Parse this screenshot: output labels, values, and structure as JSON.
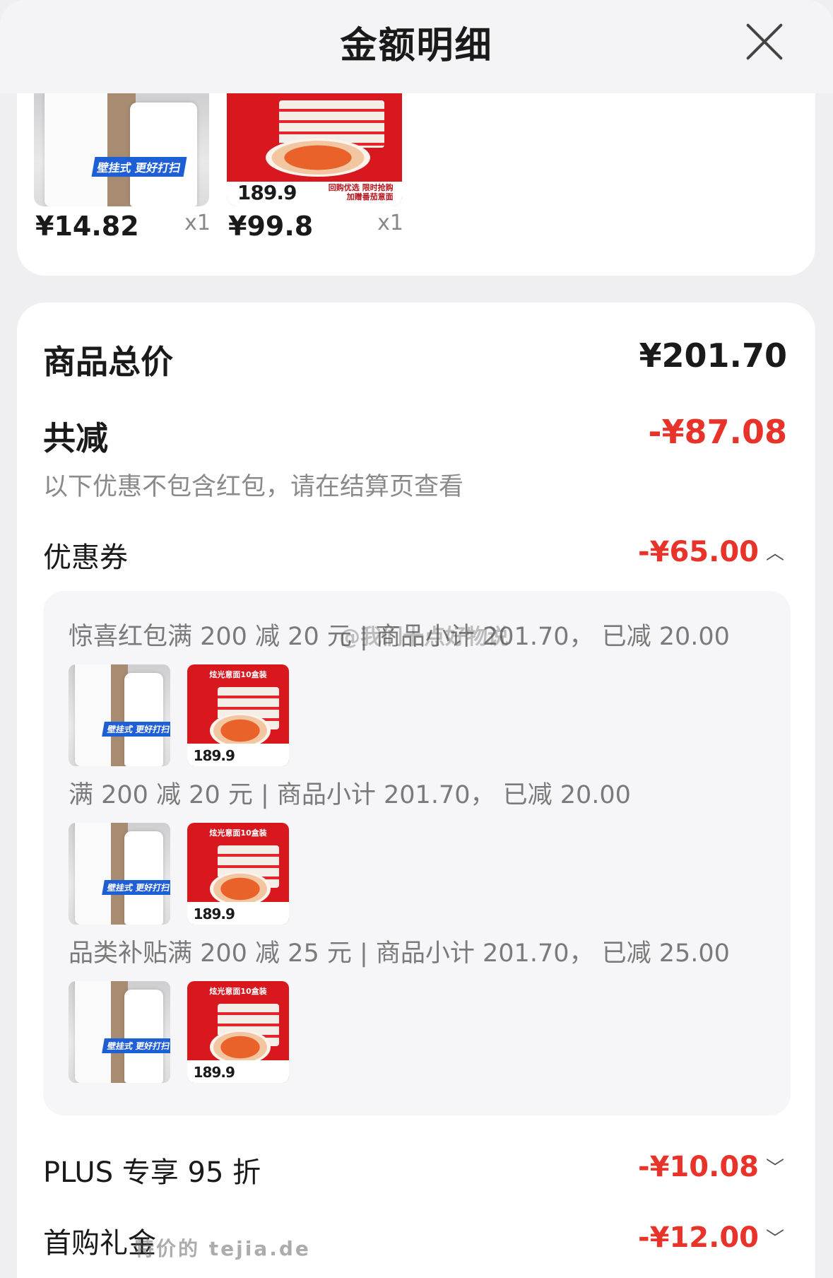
{
  "header": {
    "title": "金额明细"
  },
  "products": [
    {
      "price": "¥14.82",
      "qty": "x1",
      "tag": "壁挂式 更好打扫"
    },
    {
      "price": "¥99.8",
      "qty": "x1",
      "big_price": "189.9",
      "note": "回购优选 限时抢购\n加赠番茄意面"
    }
  ],
  "summary": {
    "total_label": "商品总价",
    "total_value": "¥201.70",
    "reduce_label": "共减",
    "reduce_value": "-¥87.08",
    "hint": "以下优惠不包含红包，请在结算页查看"
  },
  "coupon": {
    "label": "优惠券",
    "value": "-¥65.00",
    "lines": [
      "惊喜红包满 200 减 20 元 | 商品小计 201.70， 已减 20.00",
      "满 200 减 20 元 | 商品小计 201.70， 已减 20.00",
      "品类补贴满 200 减 25 元 | 商品小计 201.70， 已减 25.00"
    ],
    "thumb_text": {
      "bin_tag": "壁挂式 更好打扫",
      "pasta_top": "炫光意面10盒装",
      "pasta_price": "189.9"
    }
  },
  "plus": {
    "label": "PLUS 专享 95 折",
    "value": "-¥10.08"
  },
  "first_buy": {
    "label": "首购礼金",
    "value": "-¥12.00"
  },
  "watermarks": {
    "weibo": "@我们十点好物说",
    "site": "特价的 tejia.de"
  },
  "colors": {
    "accent_red": "#e8332b",
    "panel_bg": "#f6f6f8"
  }
}
